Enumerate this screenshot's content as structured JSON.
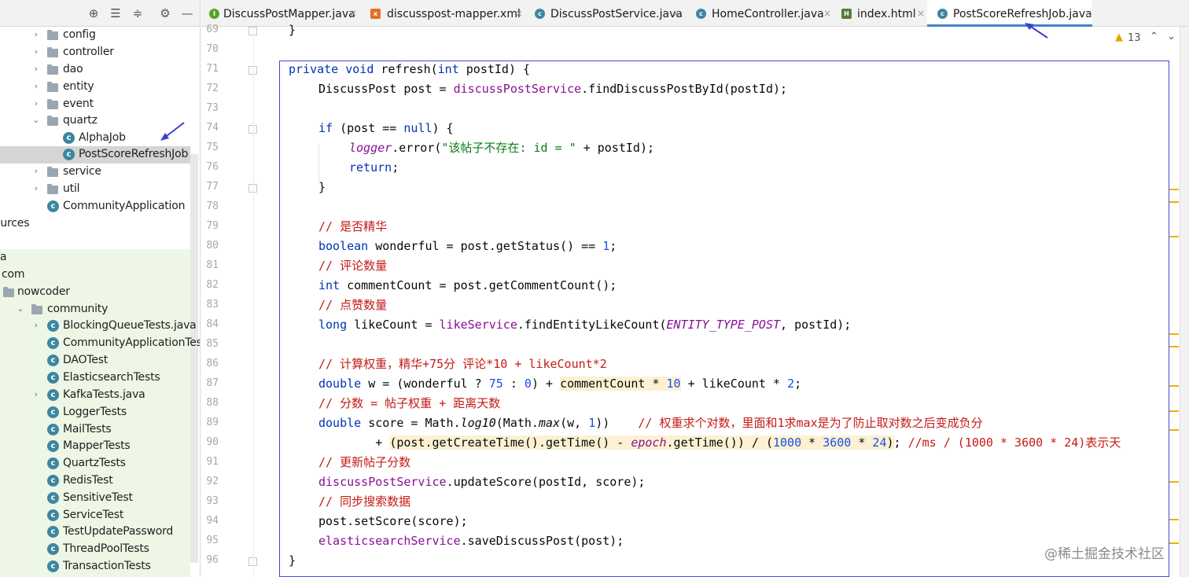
{
  "project_tree": {
    "items": [
      {
        "label": "config",
        "type": "folder",
        "expandable": true
      },
      {
        "label": "controller",
        "type": "folder",
        "expandable": true
      },
      {
        "label": "dao",
        "type": "folder",
        "expandable": true
      },
      {
        "label": "entity",
        "type": "folder",
        "expandable": true
      },
      {
        "label": "event",
        "type": "folder",
        "expandable": true
      },
      {
        "label": "quartz",
        "type": "folder",
        "expanded": true
      },
      {
        "label": "AlphaJob",
        "type": "class"
      },
      {
        "label": "PostScoreRefreshJob",
        "type": "class",
        "selected": true
      },
      {
        "label": "service",
        "type": "folder",
        "expandable": true
      },
      {
        "label": "util",
        "type": "folder",
        "expandable": true
      },
      {
        "label": "CommunityApplication",
        "type": "class"
      },
      {
        "label": "ources",
        "type": "text"
      },
      {
        "label": "a",
        "type": "text"
      },
      {
        "label": "com",
        "type": "text"
      },
      {
        "label": "nowcoder",
        "type": "folder"
      },
      {
        "label": "community",
        "type": "folder",
        "expanded": true
      },
      {
        "label": "BlockingQueueTests.java",
        "type": "class",
        "expandable": true
      },
      {
        "label": "CommunityApplicationTests",
        "type": "class"
      },
      {
        "label": "DAOTest",
        "type": "class"
      },
      {
        "label": "ElasticsearchTests",
        "type": "class"
      },
      {
        "label": "KafkaTests.java",
        "type": "class",
        "expandable": true
      },
      {
        "label": "LoggerTests",
        "type": "class"
      },
      {
        "label": "MailTests",
        "type": "class"
      },
      {
        "label": "MapperTests",
        "type": "class"
      },
      {
        "label": "QuartzTests",
        "type": "class"
      },
      {
        "label": "RedisTest",
        "type": "class"
      },
      {
        "label": "SensitiveTest",
        "type": "class"
      },
      {
        "label": "ServiceTest",
        "type": "class"
      },
      {
        "label": "TestUpdatePassword",
        "type": "class"
      },
      {
        "label": "ThreadPoolTests",
        "type": "class"
      },
      {
        "label": "TransactionTests",
        "type": "class"
      }
    ]
  },
  "tabs": [
    {
      "label": "DiscussPostMapper.java",
      "icon": "interface-icon",
      "color": "#5aa02c"
    },
    {
      "label": "discusspost-mapper.xml",
      "icon": "xml-icon",
      "color": "#e0702a"
    },
    {
      "label": "DiscussPostService.java",
      "icon": "class-icon",
      "color": "#3e86a0"
    },
    {
      "label": "HomeController.java",
      "icon": "class-icon",
      "color": "#3e86a0"
    },
    {
      "label": "index.html",
      "icon": "html-icon",
      "color": "#5a7d3a"
    },
    {
      "label": "PostScoreRefreshJob.java",
      "icon": "class-icon",
      "color": "#3e86a0",
      "active": true
    }
  ],
  "editor": {
    "line_numbers": [
      "69",
      "70",
      "71",
      "72",
      "73",
      "74",
      "75",
      "76",
      "77",
      "78",
      "79",
      "80",
      "81",
      "82",
      "83",
      "84",
      "85",
      "86",
      "87",
      "88",
      "89",
      "90",
      "91",
      "92",
      "93",
      "94",
      "95",
      "96"
    ],
    "warning_count": "13",
    "code": {
      "l69": "}",
      "l71_kw1": "private",
      "l71_kw2": "void",
      "l71_name": " refresh(",
      "l71_kw3": "int",
      "l71_rest": " postId) {",
      "l72_a": "DiscussPost post = ",
      "l72_fld": "discussPostService",
      "l72_b": ".findDiscussPostById(postId);",
      "l74_kw": "if",
      "l74_a": " (post == ",
      "l74_null": "null",
      "l74_b": ") {",
      "l75_fld": "logger",
      "l75_a": ".error(",
      "l75_str": "\"该帖子不存在: id = \"",
      "l75_b": " + postId);",
      "l76_kw": "return",
      "l76_b": ";",
      "l77": "}",
      "l79_cmt": "// 是否精华",
      "l80_kw": "boolean",
      "l80_a": " wonderful = post.getStatus() == ",
      "l80_num": "1",
      "l80_b": ";",
      "l81_cmt": "// 评论数量",
      "l82_kw": "int",
      "l82_a": " commentCount = post.getCommentCount();",
      "l83_cmt": "// 点赞数量",
      "l84_kw": "long",
      "l84_a": " likeCount = ",
      "l84_fld": "likeService",
      "l84_b": ".findEntityLikeCount(",
      "l84_const": "ENTITY_TYPE_POST",
      "l84_c": ", postId);",
      "l86_cmt": "// 计算权重，精华+75分 评论*10 + likeCount*2",
      "l87_kw": "double",
      "l87_a": " w = (wonderful ? ",
      "l87_num1": "75",
      "l87_b": " : ",
      "l87_num2": "0",
      "l87_c": ") + ",
      "l87_hl": "commentCount * ",
      "l87_num3": "10",
      "l87_d": " + likeCount * ",
      "l87_num4": "2",
      "l87_e": ";",
      "l88_cmt": "// 分数 = 帖子权重 + 距离天数",
      "l89_kw": "double",
      "l89_a": " score = Math.",
      "l89_it1": "log10",
      "l89_b": "(Math.",
      "l89_it2": "max",
      "l89_c": "(w, ",
      "l89_num": "1",
      "l89_d": "))    ",
      "l89_cmt": "// 权重求个对数，里面和1求max是为了防止取对数之后变成负分",
      "l90_a": "        + ",
      "l90_hl1": "(post.getCreateTime().getTime() - ",
      "l90_fld": "epoch",
      "l90_hl2": ".getTime()) / (",
      "l90_num1": "1000",
      "l90_hl3": " * ",
      "l90_num2": "3600",
      "l90_hl4": " * ",
      "l90_num3": "24",
      "l90_hl5": ")",
      "l90_b": "; ",
      "l90_cmt": "//ms / (1000 * 3600 * 24)表示天",
      "l91_cmt": "// 更新帖子分数",
      "l92_fld": "discussPostService",
      "l92_a": ".updateScore(postId, score);",
      "l93_cmt": "// 同步搜索数据",
      "l94_a": "post.setScore(score);",
      "l95_fld": "elasticsearchService",
      "l95_a": ".saveDiscussPost(post);",
      "l96": "}"
    }
  },
  "watermark": "@稀土掘金技术社区",
  "colors": {
    "keyword": "#0033b3",
    "field": "#871094",
    "number": "#1750eb",
    "string": "#067d17",
    "comment": "#c41a16",
    "highlight": "#fcf1d2",
    "accent": "#4083c9"
  }
}
